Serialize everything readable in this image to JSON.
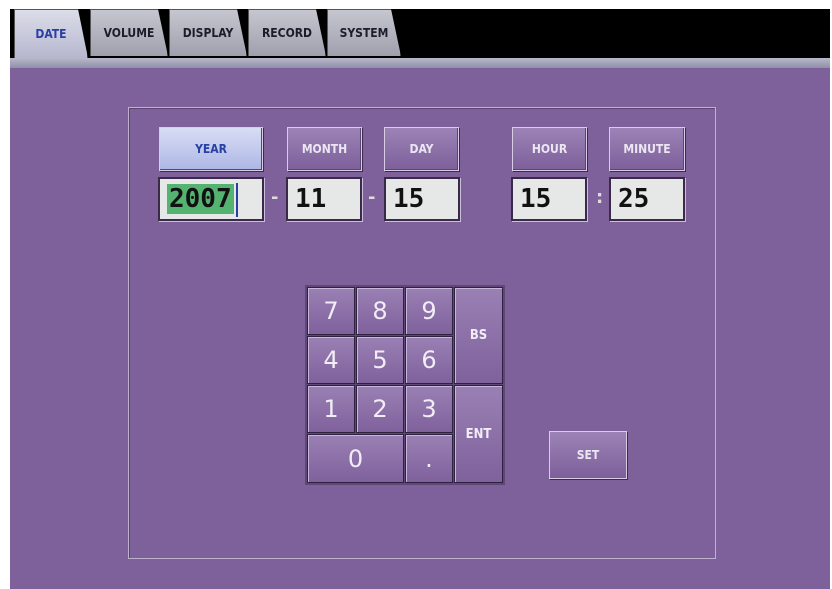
{
  "tabs": [
    {
      "label": "DATE",
      "active": true
    },
    {
      "label": "VOLUME",
      "active": false
    },
    {
      "label": "DISPLAY",
      "active": false
    },
    {
      "label": "RECORD",
      "active": false
    },
    {
      "label": "SYSTEM",
      "active": false
    }
  ],
  "datetime": {
    "year_label": "YEAR",
    "month_label": "MONTH",
    "day_label": "DAY",
    "hour_label": "HOUR",
    "minute_label": "MINUTE",
    "year_value": "2007",
    "month_value": "11",
    "day_value": "15",
    "hour_value": "15",
    "minute_value": "25",
    "date_separator": "-",
    "time_separator": ":"
  },
  "keypad": {
    "k7": "7",
    "k8": "8",
    "k9": "9",
    "k4": "4",
    "k5": "5",
    "k6": "6",
    "k1": "1",
    "k2": "2",
    "k3": "3",
    "k0": "0",
    "kdot": ".",
    "bs": "BS",
    "ent": "ENT"
  },
  "set_label": "SET",
  "colors": {
    "background": "#7e609a",
    "active_tab_text": "#2740a6",
    "field_highlight": "#55b372"
  }
}
